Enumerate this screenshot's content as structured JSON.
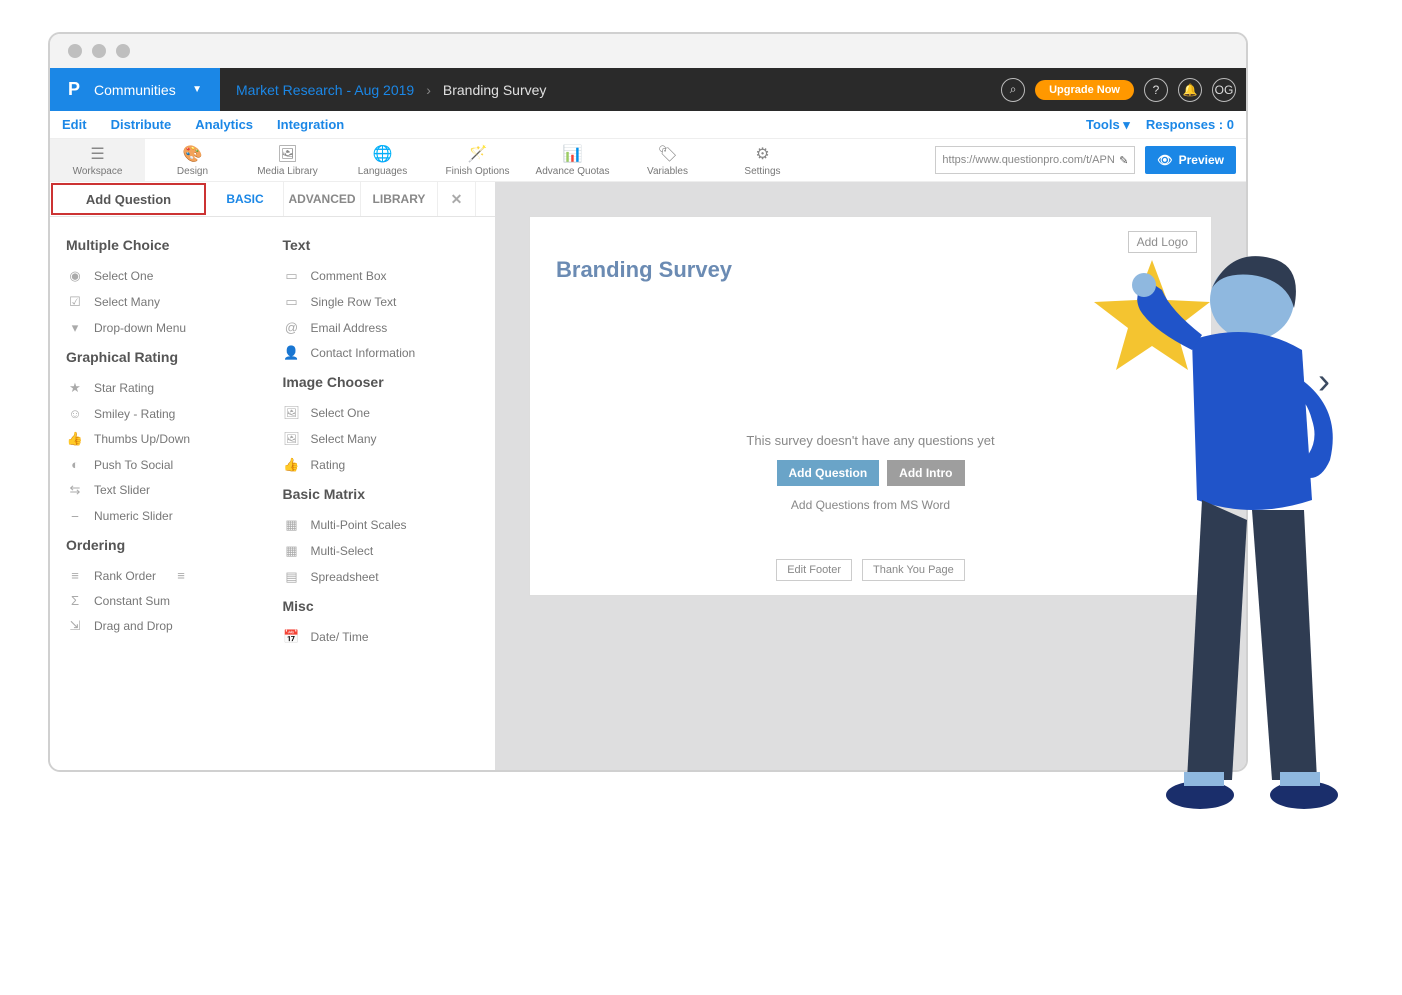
{
  "brand": {
    "name": "Communities"
  },
  "breadcrumb": {
    "project": "Market Research - Aug 2019",
    "survey": "Branding Survey"
  },
  "topnav": {
    "upgrade": "Upgrade Now",
    "avatar": "OG",
    "search_icon": "search",
    "help_icon": "help",
    "bell_icon": "notifications"
  },
  "subnav": {
    "items": [
      "Edit",
      "Distribute",
      "Analytics",
      "Integration"
    ],
    "tools": "Tools",
    "responses_label": "Responses :",
    "responses_count": 0
  },
  "toolbar": {
    "items": [
      {
        "label": "Workspace",
        "icon": "☰"
      },
      {
        "label": "Design",
        "icon": "🎨"
      },
      {
        "label": "Media Library",
        "icon": "🖼"
      },
      {
        "label": "Languages",
        "icon": "🌐"
      },
      {
        "label": "Finish Options",
        "icon": "🪄"
      },
      {
        "label": "Advance Quotas",
        "icon": "📊"
      },
      {
        "label": "Variables",
        "icon": "🏷"
      },
      {
        "label": "Settings",
        "icon": "⚙"
      }
    ],
    "url": "https://www.questionpro.com/t/APNIFZ",
    "preview": "Preview"
  },
  "qpanel": {
    "add_question": "Add Question",
    "tabs": [
      "BASIC",
      "ADVANCED",
      "LIBRARY"
    ],
    "col1": {
      "g1": {
        "title": "Multiple Choice",
        "items": [
          "Select One",
          "Select Many",
          "Drop-down Menu"
        ]
      },
      "g2": {
        "title": "Graphical Rating",
        "items": [
          "Star Rating",
          "Smiley - Rating",
          "Thumbs Up/Down",
          "Push To Social",
          "Text Slider",
          "Numeric Slider"
        ]
      },
      "g3": {
        "title": "Ordering",
        "items": [
          "Rank Order",
          "Constant Sum",
          "Drag and Drop"
        ]
      }
    },
    "col2": {
      "g1": {
        "title": "Text",
        "items": [
          "Comment Box",
          "Single Row Text",
          "Email Address",
          "Contact Information"
        ]
      },
      "g2": {
        "title": "Image Chooser",
        "items": [
          "Select One",
          "Select Many",
          "Rating"
        ]
      },
      "g3": {
        "title": "Basic Matrix",
        "items": [
          "Multi-Point Scales",
          "Multi-Select",
          "Spreadsheet"
        ]
      },
      "g4": {
        "title": "Misc",
        "items": [
          "Date/ Time"
        ]
      }
    }
  },
  "canvas": {
    "add_logo": "Add Logo",
    "survey_title": "Branding Survey",
    "empty_text": "This survey doesn't have any questions yet",
    "add_question_btn": "Add Question",
    "add_intro_btn": "Add Intro",
    "ms_word": "Add Questions from MS Word",
    "edit_footer": "Edit Footer",
    "thank_you": "Thank You Page"
  }
}
